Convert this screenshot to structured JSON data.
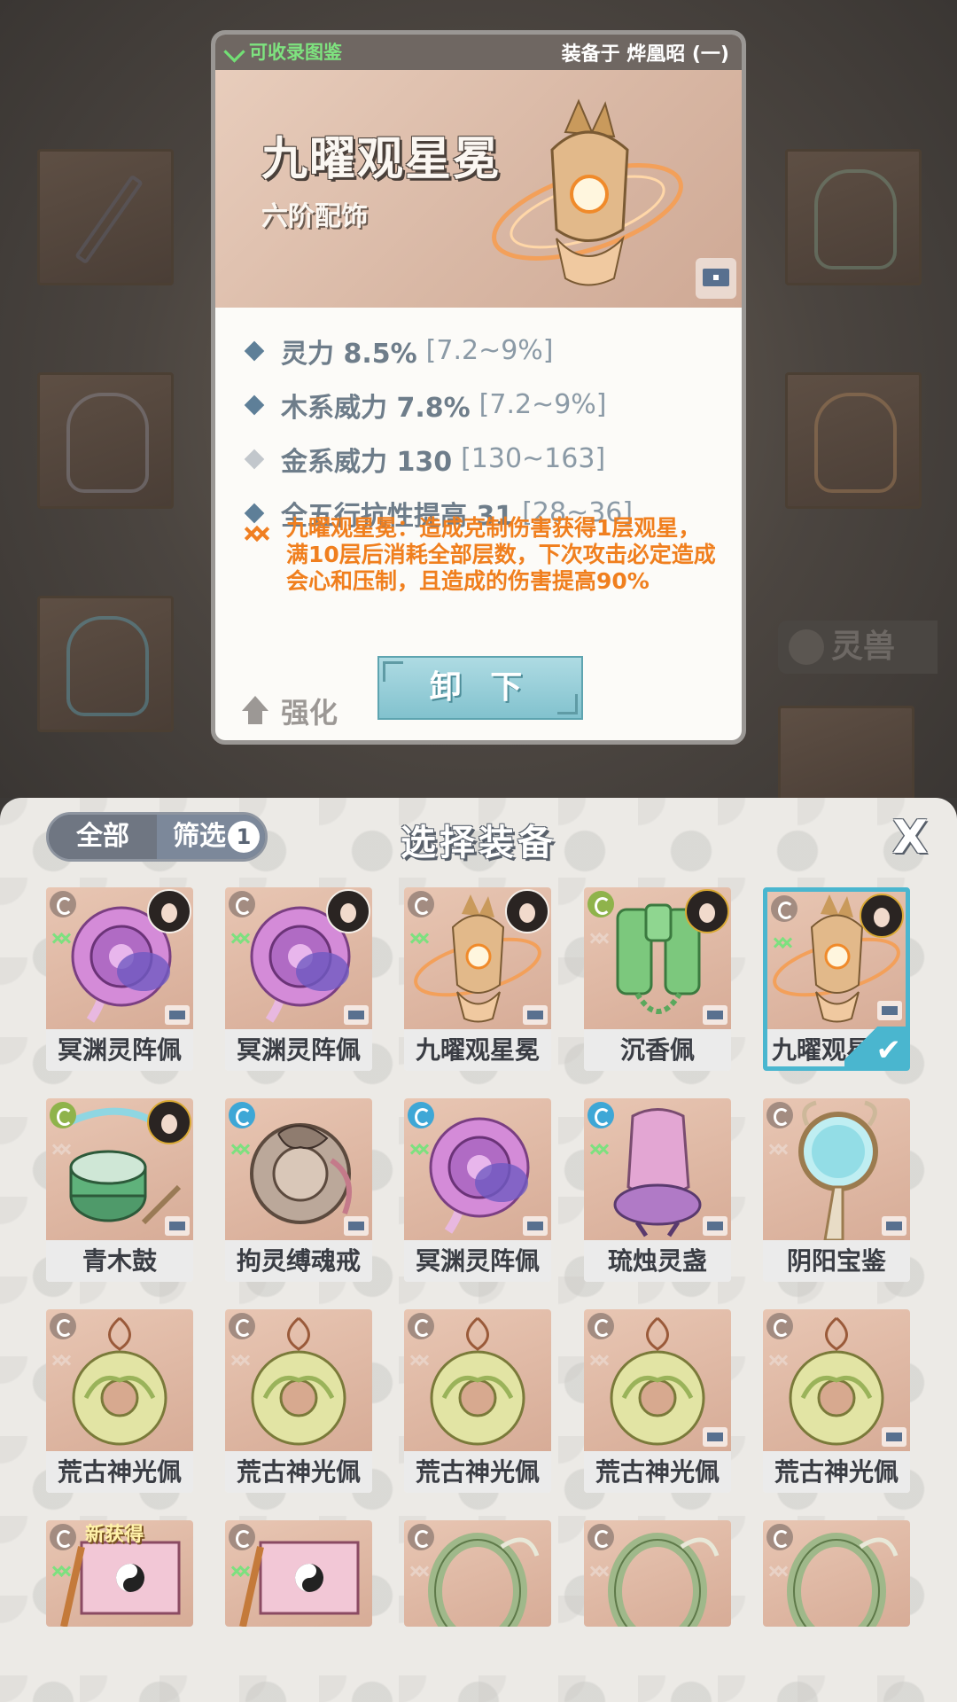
{
  "detail": {
    "collect_label": "可收录图鉴",
    "equipped_on": "装备于 烨凰昭 (一)",
    "name": "九曜观星冕",
    "grade": "六阶配饰",
    "stats": [
      {
        "label": "灵力 8.5%",
        "range": "[7.2~9%]",
        "active": true
      },
      {
        "label": "木系威力 7.8%",
        "range": "[7.2~9%]",
        "active": true
      },
      {
        "label": "金系威力 130",
        "range": "[130~163]",
        "active": false
      },
      {
        "label": "全五行抗性提高 31",
        "range": "[28~36]",
        "active": true
      }
    ],
    "special_effect": "九曜观星冕：造成克制伤害获得1层观星，满10层后消耗全部层数，下次攻击必定造成会心和压制，且造成的伤害提高90%",
    "upgrade_label": "强化",
    "unequip_label": "卸 下"
  },
  "background": {
    "tab_label": "灵兽"
  },
  "panel": {
    "tab_all": "全部",
    "tab_filter": "筛选",
    "filter_count": "1",
    "title": "选择装备",
    "close_label": "X"
  },
  "items": [
    {
      "name": "冥渊灵阵佩",
      "art": "pink-disc",
      "icon": "brown",
      "collect": true,
      "avatar": true,
      "chest": true
    },
    {
      "name": "冥渊灵阵佩",
      "art": "pink-disc",
      "icon": "brown",
      "collect": true,
      "avatar": true,
      "chest": true
    },
    {
      "name": "九曜观星冕",
      "art": "crown",
      "icon": "brown",
      "collect": true,
      "avatar": true,
      "chest": true
    },
    {
      "name": "沉香佩",
      "art": "jade",
      "icon": "green",
      "collect": false,
      "avatar": true,
      "chest": true
    },
    {
      "name": "九曜观星",
      "art": "crown",
      "icon": "brown",
      "collect": true,
      "avatar": true,
      "chest": true,
      "selected": true
    },
    {
      "name": "青木鼓",
      "art": "drum",
      "icon": "green",
      "collect": false,
      "avatar": true,
      "chest": true
    },
    {
      "name": "拘灵缚魂戒",
      "art": "ring-beast",
      "icon": "blue",
      "collect": true,
      "avatar": false,
      "chest": true
    },
    {
      "name": "冥渊灵阵佩",
      "art": "pink-disc",
      "icon": "blue",
      "collect": true,
      "avatar": false,
      "chest": true
    },
    {
      "name": "琉烛灵盏",
      "art": "lamp",
      "icon": "blue",
      "collect": true,
      "avatar": false,
      "chest": true
    },
    {
      "name": "阴阳宝鉴",
      "art": "mirror",
      "icon": "brown",
      "collect": false,
      "avatar": false,
      "chest": true
    },
    {
      "name": "荒古神光佩",
      "art": "pendant",
      "icon": "brown",
      "collect": false,
      "avatar": false,
      "chest": false
    },
    {
      "name": "荒古神光佩",
      "art": "pendant",
      "icon": "brown",
      "collect": false,
      "avatar": false,
      "chest": false
    },
    {
      "name": "荒古神光佩",
      "art": "pendant",
      "icon": "brown",
      "collect": false,
      "avatar": false,
      "chest": false
    },
    {
      "name": "荒古神光佩",
      "art": "pendant",
      "icon": "brown",
      "collect": false,
      "avatar": false,
      "chest": true
    },
    {
      "name": "荒古神光佩",
      "art": "pendant",
      "icon": "brown",
      "collect": false,
      "avatar": false,
      "chest": true
    },
    {
      "name": "",
      "art": "scroll",
      "icon": "brown",
      "collect": true,
      "avatar": false,
      "chest": false,
      "new_tag": "新获得"
    },
    {
      "name": "",
      "art": "scroll",
      "icon": "brown",
      "collect": true,
      "avatar": false,
      "chest": false
    },
    {
      "name": "",
      "art": "bangle",
      "icon": "brown",
      "collect": false,
      "avatar": false,
      "chest": false
    },
    {
      "name": "",
      "art": "bangle",
      "icon": "brown",
      "collect": false,
      "avatar": false,
      "chest": false
    },
    {
      "name": "",
      "art": "bangle",
      "icon": "brown",
      "collect": false,
      "avatar": false,
      "chest": false
    }
  ]
}
